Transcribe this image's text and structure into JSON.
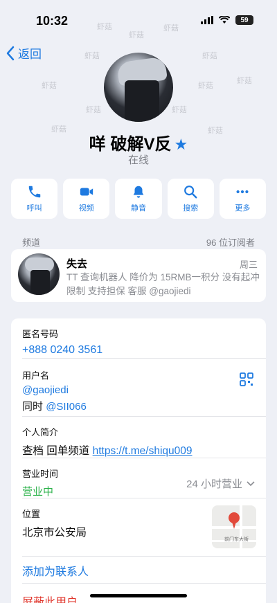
{
  "status_bar": {
    "time": "10:32",
    "battery": "59"
  },
  "nav": {
    "back_label": "返回"
  },
  "watermark": {
    "text": "虾菇"
  },
  "profile": {
    "name": "咩 破解V反",
    "presence": "在线"
  },
  "actions": [
    {
      "label": "呼叫",
      "icon": "phone-icon"
    },
    {
      "label": "视频",
      "icon": "video-icon"
    },
    {
      "label": "静音",
      "icon": "bell-icon"
    },
    {
      "label": "搜索",
      "icon": "search-icon"
    },
    {
      "label": "更多",
      "icon": "more-icon"
    }
  ],
  "channel": {
    "section_label": "频道",
    "subscribers": "96 位订阅者",
    "title": "失去",
    "day": "周三",
    "message": "TT 查询机器人 降价为 15RMB一积分 没有起冲限制 支持担保 客服 @gaojiedi"
  },
  "info": {
    "anon_number": {
      "label": "匿名号码",
      "value": "+888 0240 3561"
    },
    "username": {
      "label": "用户名",
      "value": "@gaojiedi",
      "also_prefix": "同时",
      "also_value": "@SII066"
    },
    "bio": {
      "label": "个人简介",
      "text": "查档 回单频道",
      "link": "https://t.me/shiqu009"
    },
    "hours": {
      "label": "营业时间",
      "status": "营业中",
      "detail": "24 小时营业"
    },
    "location": {
      "label": "位置",
      "value": "北京市公安局",
      "map_text": "前门东大街"
    },
    "add_contact": "添加为联系人",
    "block_user": "屏蔽此用户"
  },
  "colors": {
    "accent": "#1e7ae0",
    "open_green": "#2bb24a",
    "danger": "#e0352b"
  }
}
